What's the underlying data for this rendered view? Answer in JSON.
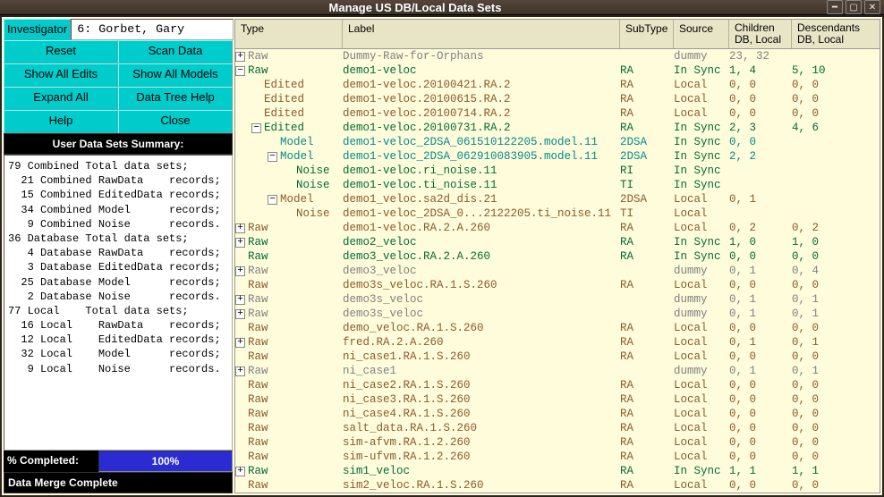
{
  "title": "Manage US DB/Local Data Sets",
  "sidebar": {
    "investigator_label": "Investigator",
    "investigator_value": "6: Gorbet, Gary",
    "buttons": {
      "reset": "Reset",
      "scan_data": "Scan Data",
      "show_all_edits": "Show All Edits",
      "show_all_models": "Show All Models",
      "expand_all": "Expand All",
      "data_tree_help": "Data Tree Help",
      "help": "Help",
      "close": "Close"
    },
    "summary_header": "User Data Sets Summary:",
    "summary_text": "79 Combined Total data sets;\n  21 Combined RawData    records;\n  15 Combined EditedData records;\n  34 Combined Model      records;\n   9 Combined Noise      records.\n36 Database Total data sets;\n   4 Database RawData    records;\n   3 Database EditedData records;\n  25 Database Model      records;\n   2 Database Noise      records.\n77 Local    Total data sets;\n  16 Local    RawData    records;\n  12 Local    EditedData records;\n  32 Local    Model      records;\n   9 Local    Noise      records.",
    "progress_label": "% Completed:",
    "progress_value": "100%",
    "status_text": "Data Merge Complete"
  },
  "columns": {
    "type": "Type",
    "label": "Label",
    "subtype": "SubType",
    "source": "Source",
    "children": "Children\nDB, Local",
    "descendants": "Descendants\nDB, Local"
  },
  "rows": [
    {
      "depth": 0,
      "exp": "+",
      "type": "Raw",
      "type_c": "gray",
      "label": "Dummy-Raw-for-Orphans",
      "label_c": "gray",
      "sub": "",
      "source": "dummy",
      "src_c": "gray",
      "child": "23, 32",
      "desc": ""
    },
    {
      "depth": 0,
      "exp": "-",
      "type": "Raw",
      "type_c": "green",
      "label": "demo1-veloc",
      "label_c": "green",
      "sub": "RA",
      "source": "In Sync",
      "src_c": "green",
      "child": "1, 4",
      "desc": "5, 10"
    },
    {
      "depth": 1,
      "exp": "",
      "type": "Edited",
      "type_c": "brown",
      "label": "demo1-veloc.20100421.RA.2",
      "label_c": "brown",
      "sub": "RA",
      "source": "Local",
      "src_c": "brown",
      "child": "0, 0",
      "desc": "0, 0"
    },
    {
      "depth": 1,
      "exp": "",
      "type": "Edited",
      "type_c": "brown",
      "label": "demo1-veloc.20100615.RA.2",
      "label_c": "brown",
      "sub": "RA",
      "source": "Local",
      "src_c": "brown",
      "child": "0, 0",
      "desc": "0, 0"
    },
    {
      "depth": 1,
      "exp": "",
      "type": "Edited",
      "type_c": "brown",
      "label": "demo1-veloc.20100714.RA.2",
      "label_c": "brown",
      "sub": "RA",
      "source": "Local",
      "src_c": "brown",
      "child": "0, 0",
      "desc": "0, 0"
    },
    {
      "depth": 1,
      "exp": "-",
      "type": "Edited",
      "type_c": "green",
      "label": "demo1-veloc.20100731.RA.2",
      "label_c": "green",
      "sub": "RA",
      "source": "In Sync",
      "src_c": "green",
      "child": "2, 3",
      "desc": "4, 6"
    },
    {
      "depth": 2,
      "exp": "",
      "type": "Model",
      "type_c": "teal",
      "label": "demo1-veloc_2DSA_061510122205.model.11",
      "label_c": "teal",
      "sub": "2DSA",
      "sub_c": "teal",
      "source": "In Sync",
      "src_c": "green",
      "child": "0, 0",
      "desc": ""
    },
    {
      "depth": 2,
      "exp": "-",
      "type": "Model",
      "type_c": "teal",
      "label": "demo1-veloc_2DSA_062910083905.model.11",
      "label_c": "teal",
      "sub": "2DSA",
      "sub_c": "teal",
      "source": "In Sync",
      "src_c": "green",
      "child": "2, 2",
      "desc": ""
    },
    {
      "depth": 3,
      "exp": "",
      "type": "Noise",
      "type_c": "green",
      "label": "demo1-veloc.ri_noise.11",
      "label_c": "green",
      "sub": "RI",
      "sub_c": "green",
      "source": "In Sync",
      "src_c": "green",
      "child": "",
      "desc": ""
    },
    {
      "depth": 3,
      "exp": "",
      "type": "Noise",
      "type_c": "green",
      "label": "demo1-veloc.ti_noise.11",
      "label_c": "green",
      "sub": "TI",
      "sub_c": "green",
      "source": "In Sync",
      "src_c": "green",
      "child": "",
      "desc": ""
    },
    {
      "depth": 2,
      "exp": "-",
      "type": "Model",
      "type_c": "brown",
      "label": "demo1_veloc.sa2d_dis.21",
      "label_c": "brown",
      "sub": "2DSA",
      "sub_c": "brown",
      "source": "Local",
      "src_c": "brown",
      "child": "0, 1",
      "desc": ""
    },
    {
      "depth": 3,
      "exp": "",
      "type": "Noise",
      "type_c": "brown",
      "label": "demo1-veloc_2DSA_0...2122205.ti_noise.11",
      "label_c": "brown",
      "sub": "TI",
      "sub_c": "brown",
      "source": "Local",
      "src_c": "brown",
      "child": "",
      "desc": ""
    },
    {
      "depth": 0,
      "exp": "+",
      "type": "Raw",
      "type_c": "brown",
      "label": "demo1-veloc.RA.2.A.260",
      "label_c": "brown",
      "sub": "RA",
      "source": "Local",
      "src_c": "brown",
      "child": "0, 2",
      "desc": "0, 2"
    },
    {
      "depth": 0,
      "exp": "+",
      "type": "Raw",
      "type_c": "green",
      "label": "demo2_veloc",
      "label_c": "green",
      "sub": "RA",
      "source": "In Sync",
      "src_c": "green",
      "child": "1, 0",
      "desc": "1, 0"
    },
    {
      "depth": 0,
      "exp": "",
      "type": "Raw",
      "type_c": "green",
      "label": "demo3_veloc.RA.2.A.260",
      "label_c": "green",
      "sub": "RA",
      "source": "In Sync",
      "src_c": "green",
      "child": "0, 0",
      "desc": "0, 0"
    },
    {
      "depth": 0,
      "exp": "+",
      "type": "Raw",
      "type_c": "gray",
      "label": "demo3_veloc",
      "label_c": "gray",
      "sub": "",
      "source": "dummy",
      "src_c": "gray",
      "child": "0, 1",
      "desc": "0, 4"
    },
    {
      "depth": 0,
      "exp": "",
      "type": "Raw",
      "type_c": "brown",
      "label": "demo3s_veloc.RA.1.S.260",
      "label_c": "brown",
      "sub": "RA",
      "source": "Local",
      "src_c": "brown",
      "child": "0, 0",
      "desc": "0, 0"
    },
    {
      "depth": 0,
      "exp": "+",
      "type": "Raw",
      "type_c": "gray",
      "label": "demo3s_veloc",
      "label_c": "gray",
      "sub": "",
      "source": "dummy",
      "src_c": "gray",
      "child": "0, 1",
      "desc": "0, 1"
    },
    {
      "depth": 0,
      "exp": "+",
      "type": "Raw",
      "type_c": "gray",
      "label": "demo3s_veloc",
      "label_c": "gray",
      "sub": "",
      "source": "dummy",
      "src_c": "gray",
      "child": "0, 1",
      "desc": "0, 1"
    },
    {
      "depth": 0,
      "exp": "",
      "type": "Raw",
      "type_c": "brown",
      "label": "demo_veloc.RA.1.S.260",
      "label_c": "brown",
      "sub": "RA",
      "source": "Local",
      "src_c": "brown",
      "child": "0, 0",
      "desc": "0, 0"
    },
    {
      "depth": 0,
      "exp": "+",
      "type": "Raw",
      "type_c": "brown",
      "label": "fred.RA.2.A.260",
      "label_c": "brown",
      "sub": "RA",
      "source": "Local",
      "src_c": "brown",
      "child": "0, 1",
      "desc": "0, 1"
    },
    {
      "depth": 0,
      "exp": "",
      "type": "Raw",
      "type_c": "brown",
      "label": "ni_case1.RA.1.S.260",
      "label_c": "brown",
      "sub": "RA",
      "source": "Local",
      "src_c": "brown",
      "child": "0, 0",
      "desc": "0, 0"
    },
    {
      "depth": 0,
      "exp": "+",
      "type": "Raw",
      "type_c": "gray",
      "label": "ni_case1",
      "label_c": "gray",
      "sub": "",
      "source": "dummy",
      "src_c": "gray",
      "child": "0, 1",
      "desc": "0, 1"
    },
    {
      "depth": 0,
      "exp": "",
      "type": "Raw",
      "type_c": "brown",
      "label": "ni_case2.RA.1.S.260",
      "label_c": "brown",
      "sub": "RA",
      "source": "Local",
      "src_c": "brown",
      "child": "0, 0",
      "desc": "0, 0"
    },
    {
      "depth": 0,
      "exp": "",
      "type": "Raw",
      "type_c": "brown",
      "label": "ni_case3.RA.1.S.260",
      "label_c": "brown",
      "sub": "RA",
      "source": "Local",
      "src_c": "brown",
      "child": "0, 0",
      "desc": "0, 0"
    },
    {
      "depth": 0,
      "exp": "",
      "type": "Raw",
      "type_c": "brown",
      "label": "ni_case4.RA.1.S.260",
      "label_c": "brown",
      "sub": "RA",
      "source": "Local",
      "src_c": "brown",
      "child": "0, 0",
      "desc": "0, 0"
    },
    {
      "depth": 0,
      "exp": "",
      "type": "Raw",
      "type_c": "brown",
      "label": "salt_data.RA.1.S.260",
      "label_c": "brown",
      "sub": "RA",
      "source": "Local",
      "src_c": "brown",
      "child": "0, 0",
      "desc": "0, 0"
    },
    {
      "depth": 0,
      "exp": "",
      "type": "Raw",
      "type_c": "brown",
      "label": "sim-afvm.RA.1.2.260",
      "label_c": "brown",
      "sub": "RA",
      "source": "Local",
      "src_c": "brown",
      "child": "0, 0",
      "desc": "0, 0"
    },
    {
      "depth": 0,
      "exp": "",
      "type": "Raw",
      "type_c": "brown",
      "label": "sim-ufvm.RA.1.2.260",
      "label_c": "brown",
      "sub": "RA",
      "source": "Local",
      "src_c": "brown",
      "child": "0, 0",
      "desc": "0, 0"
    },
    {
      "depth": 0,
      "exp": "+",
      "type": "Raw",
      "type_c": "green",
      "label": "sim1_veloc",
      "label_c": "green",
      "sub": "RA",
      "source": "In Sync",
      "src_c": "green",
      "child": "1, 1",
      "desc": "1, 1"
    },
    {
      "depth": 0,
      "exp": "",
      "type": "Raw",
      "type_c": "brown",
      "label": "sim2_veloc.RA.1.S.260",
      "label_c": "brown",
      "sub": "RA",
      "source": "Local",
      "src_c": "brown",
      "child": "0, 0",
      "desc": "0, 0"
    }
  ]
}
